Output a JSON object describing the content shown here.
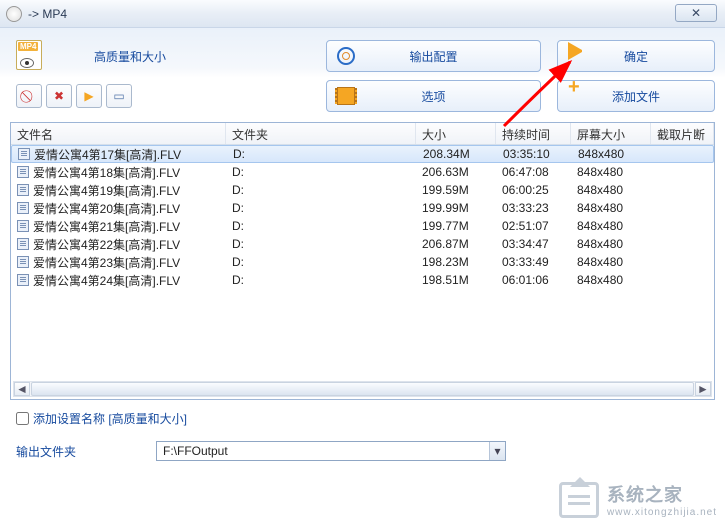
{
  "window": {
    "title": " -> MP4",
    "close_glyph": "✕"
  },
  "top": {
    "badge": "MP4",
    "quality_label": "高质量和大小",
    "output_btn": "输出配置",
    "ok_btn": "确定",
    "options_btn": "选项",
    "add_btn": "添加文件"
  },
  "toolbar_icons": {
    "b1": "⃠",
    "b2": "✖",
    "b3": "▶",
    "b4": "▭"
  },
  "table": {
    "headers": {
      "name": "文件名",
      "folder": "文件夹",
      "size": "大小",
      "dur": "持续时间",
      "dim": "屏幕大小",
      "clip": "截取片断"
    },
    "rows": [
      {
        "name": "爱情公寓4第17集[高清].FLV",
        "folder": "D:",
        "size": "208.34M",
        "dur": "03:35:10",
        "dim": "848x480"
      },
      {
        "name": "爱情公寓4第18集[高清].FLV",
        "folder": "D:",
        "size": "206.63M",
        "dur": "06:47:08",
        "dim": "848x480"
      },
      {
        "name": "爱情公寓4第19集[高清].FLV",
        "folder": "D:",
        "size": "199.59M",
        "dur": "06:00:25",
        "dim": "848x480"
      },
      {
        "name": "爱情公寓4第20集[高清].FLV",
        "folder": "D:",
        "size": "199.99M",
        "dur": "03:33:23",
        "dim": "848x480"
      },
      {
        "name": "爱情公寓4第21集[高清].FLV",
        "folder": "D:",
        "size": "199.77M",
        "dur": "02:51:07",
        "dim": "848x480"
      },
      {
        "name": "爱情公寓4第22集[高清].FLV",
        "folder": "D:",
        "size": "206.87M",
        "dur": "03:34:47",
        "dim": "848x480"
      },
      {
        "name": "爱情公寓4第23集[高清].FLV",
        "folder": "D:",
        "size": "198.23M",
        "dur": "03:33:49",
        "dim": "848x480"
      },
      {
        "name": "爱情公寓4第24集[高清].FLV",
        "folder": "D:",
        "size": "198.51M",
        "dur": "06:01:06",
        "dim": "848x480"
      }
    ],
    "scroll": {
      "left": "◄",
      "right": "►"
    }
  },
  "check": {
    "label": "添加设置名称 [高质量和大小]"
  },
  "output": {
    "label": "输出文件夹",
    "value": "F:\\FFOutput",
    "dd": "▾"
  },
  "watermark": {
    "big": "系统之家",
    "small": "www.xitongzhijia.net"
  }
}
